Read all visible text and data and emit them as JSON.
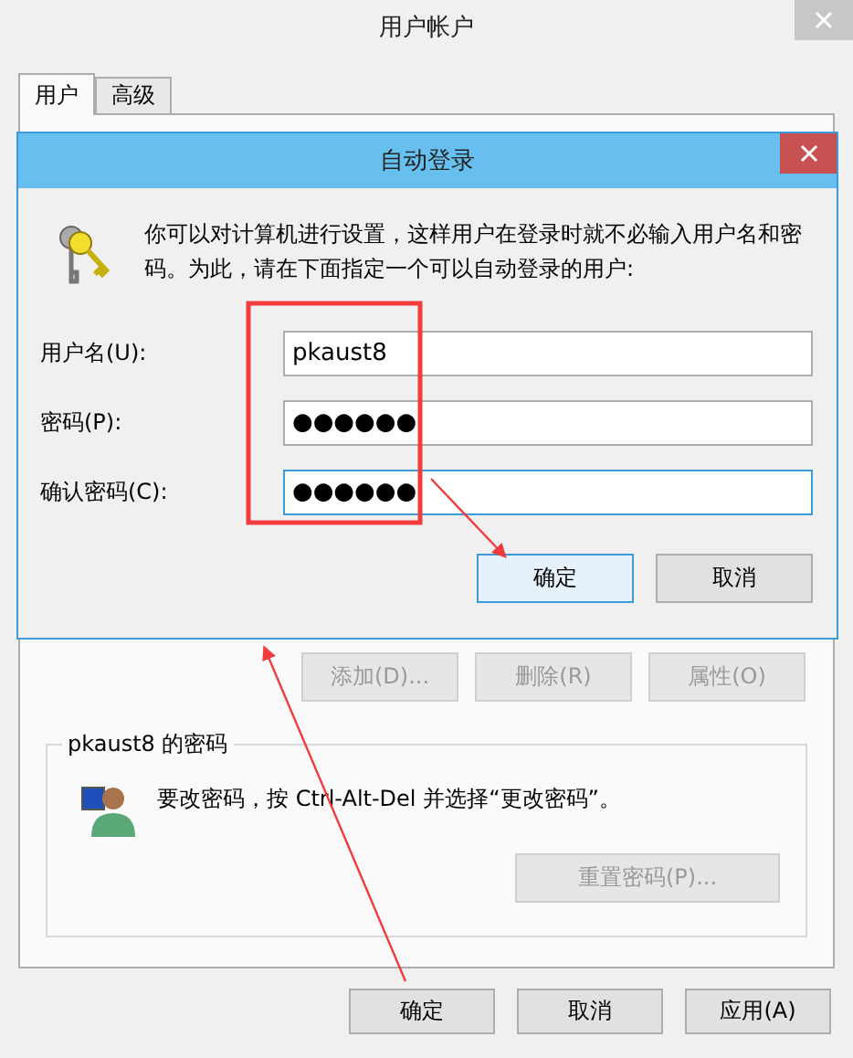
{
  "window": {
    "title": "用户帐户"
  },
  "tabs": [
    {
      "label": "用户",
      "selected": true
    },
    {
      "label": "高级",
      "selected": false
    }
  ],
  "user_buttons": [
    {
      "label": "添加(D)...",
      "disabled": true
    },
    {
      "label": "删除(R)",
      "disabled": true
    },
    {
      "label": "属性(O)",
      "disabled": true
    }
  ],
  "password_group": {
    "title": "pkaust8 的密码",
    "message": "要改密码，按 Ctrl-Alt-Del 并选择“更改密码”。",
    "button": {
      "label": "重置密码(P)...",
      "disabled": true
    }
  },
  "footer_buttons": [
    {
      "label": "确定"
    },
    {
      "label": "取消"
    },
    {
      "label": "应用(A)"
    }
  ],
  "dialog": {
    "title": "自动登录",
    "description": "你可以对计算机进行设置，这样用户在登录时就不必输入用户名和密码。为此，请在下面指定一个可以自动登录的用户:",
    "fields": [
      {
        "label": "用户名(U):",
        "value": "pkaust8",
        "focused": false
      },
      {
        "label": "密码(P):",
        "value": "●●●●●●",
        "focused": false
      },
      {
        "label": "确认密码(C):",
        "value": "●●●●●●",
        "focused": true
      }
    ],
    "buttons": [
      {
        "label": "确定",
        "default": true
      },
      {
        "label": "取消",
        "default": false
      }
    ]
  }
}
